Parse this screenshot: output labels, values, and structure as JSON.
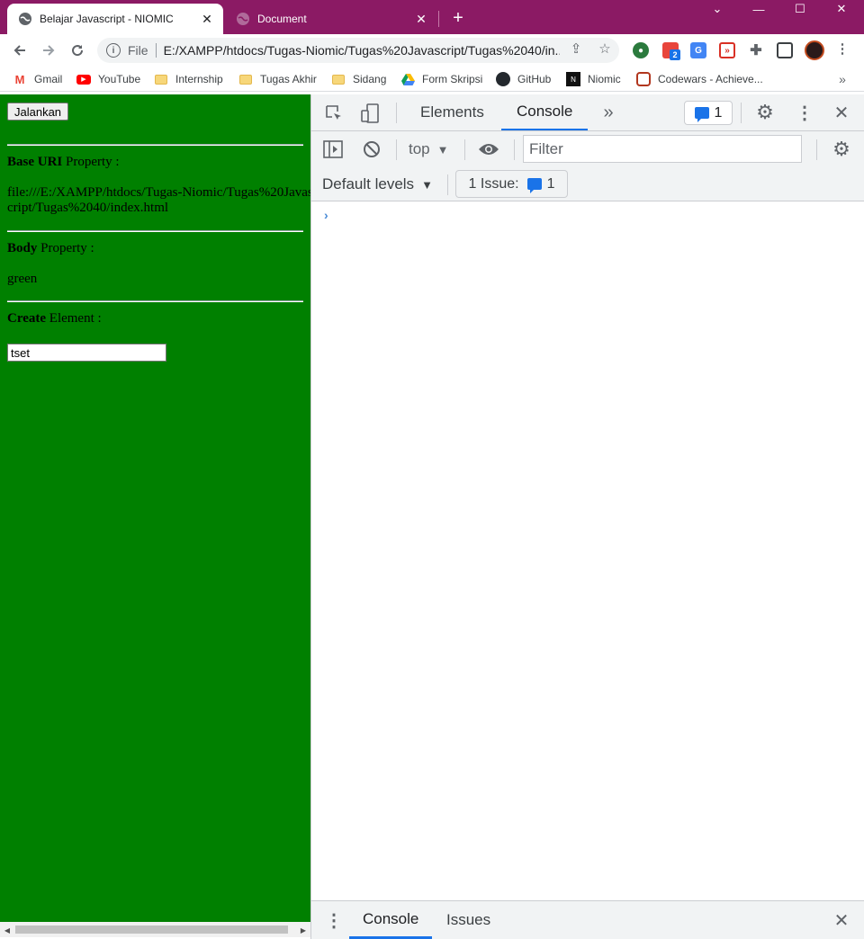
{
  "tabs": [
    {
      "title": "Belajar Javascript - NIOMIC",
      "active": true
    },
    {
      "title": "Document",
      "active": false
    }
  ],
  "toolbar": {
    "scheme": "File",
    "url": "E:/XAMPP/htdocs/Tugas-Niomic/Tugas%20Javascript/Tugas%2040/in...",
    "extension_badge": "2"
  },
  "bookmarks": [
    {
      "label": "Gmail",
      "icon": "gmail-icon"
    },
    {
      "label": "YouTube",
      "icon": "youtube-icon"
    },
    {
      "label": "Internship",
      "icon": "folder-icon"
    },
    {
      "label": "Tugas Akhir",
      "icon": "folder-icon"
    },
    {
      "label": "Sidang",
      "icon": "folder-icon"
    },
    {
      "label": "Form Skripsi",
      "icon": "drive-icon"
    },
    {
      "label": "GitHub",
      "icon": "github-icon"
    },
    {
      "label": "Niomic",
      "icon": "niomic-icon"
    },
    {
      "label": "Codewars - Achieve...",
      "icon": "codewars-icon"
    }
  ],
  "page": {
    "run_button": "Jalankan",
    "base_uri_bold": "Base URI",
    "base_uri_rest": " Property :",
    "base_uri_value": "file:///E:/XAMPP/htdocs/Tugas-Niomic/Tugas%20Javascript/Tugas%2040/index.html",
    "body_bold": "Body",
    "body_rest": " Property :",
    "body_value": "green",
    "create_bold": "Create",
    "create_rest": " Element :",
    "input_value": "tset",
    "background_color": "#008000"
  },
  "devtools": {
    "tab_elements": "Elements",
    "tab_console": "Console",
    "issues_count": "1",
    "context": "top",
    "filter_placeholder": "Filter",
    "levels": "Default levels",
    "issue_label": "1 Issue:",
    "issue_count": "1",
    "drawer_console": "Console",
    "drawer_issues": "Issues",
    "accent": "#1a73e8"
  }
}
